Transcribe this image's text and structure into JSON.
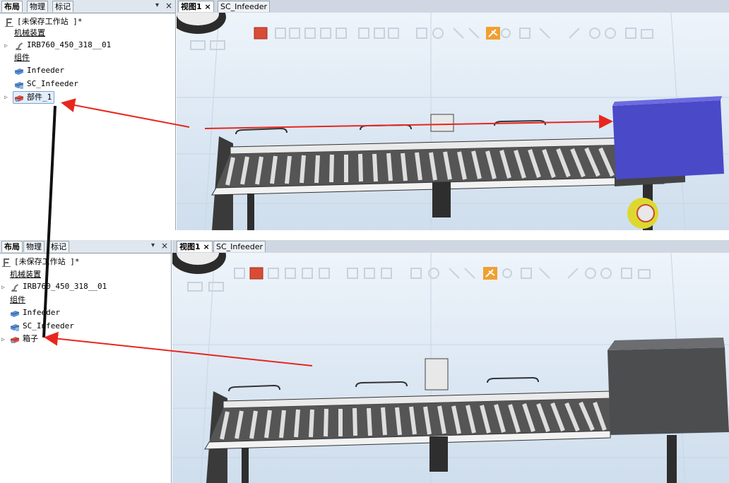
{
  "top": {
    "left_tabs": [
      "布局",
      "物理",
      "标记"
    ],
    "pin": "▾",
    "close": "×",
    "tree": {
      "station": "[未保存工作站 ]*",
      "mechanisms_header": "机械装置",
      "robot": "IRB760_450_318__01",
      "components_header": "组件",
      "items": [
        "Infeeder",
        "SC_Infeeder",
        "部件_1"
      ]
    },
    "view_tabs": [
      "视图1",
      "SC_Infeeder"
    ],
    "view_close": "×",
    "box_color": "#4a49c8"
  },
  "bottom": {
    "left_tabs": [
      "布局",
      "物理",
      "标记"
    ],
    "pin": "▾",
    "close": "×",
    "tree": {
      "station": "[未保存工作站 ]*",
      "mechanisms_header": "机械装置",
      "robot": "IRB760_450_318__01",
      "components_header": "组件",
      "items": [
        "Infeeder",
        "SC_Infeeder",
        "箱子"
      ]
    },
    "view_tabs": [
      "视图1",
      "SC_Infeeder"
    ],
    "view_close": "×",
    "box_color": "#4b4d4f"
  },
  "annotation_color": "#e8261e",
  "icons": {
    "station": "station-icon",
    "robot": "robot-icon",
    "component": "component-icon",
    "part": "part-icon"
  }
}
